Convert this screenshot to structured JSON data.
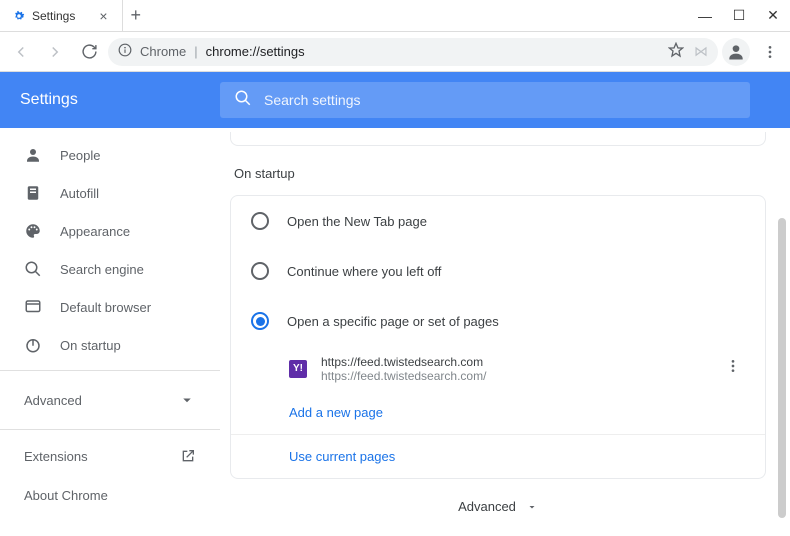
{
  "window": {
    "tab_title": "Settings",
    "min": "—",
    "max": "☐",
    "close": "✕",
    "new_tab": "+",
    "tab_close": "×"
  },
  "toolbar": {
    "secure_label": "Chrome",
    "url_path": "chrome://settings"
  },
  "header": {
    "title": "Settings",
    "search_placeholder": "Search settings"
  },
  "sidebar": {
    "items": [
      {
        "label": "People"
      },
      {
        "label": "Autofill"
      },
      {
        "label": "Appearance"
      },
      {
        "label": "Search engine"
      },
      {
        "label": "Default browser"
      },
      {
        "label": "On startup"
      }
    ],
    "advanced_label": "Advanced",
    "extensions_label": "Extensions",
    "about_label": "About Chrome"
  },
  "main": {
    "section_title": "On startup",
    "radios": [
      {
        "label": "Open the New Tab page"
      },
      {
        "label": "Continue where you left off"
      },
      {
        "label": "Open a specific page or set of pages"
      }
    ],
    "page": {
      "title": "https://feed.twistedsearch.com",
      "url": "https://feed.twistedsearch.com/"
    },
    "add_link": "Add a new page",
    "use_link": "Use current pages",
    "advanced_footer": "Advanced"
  }
}
